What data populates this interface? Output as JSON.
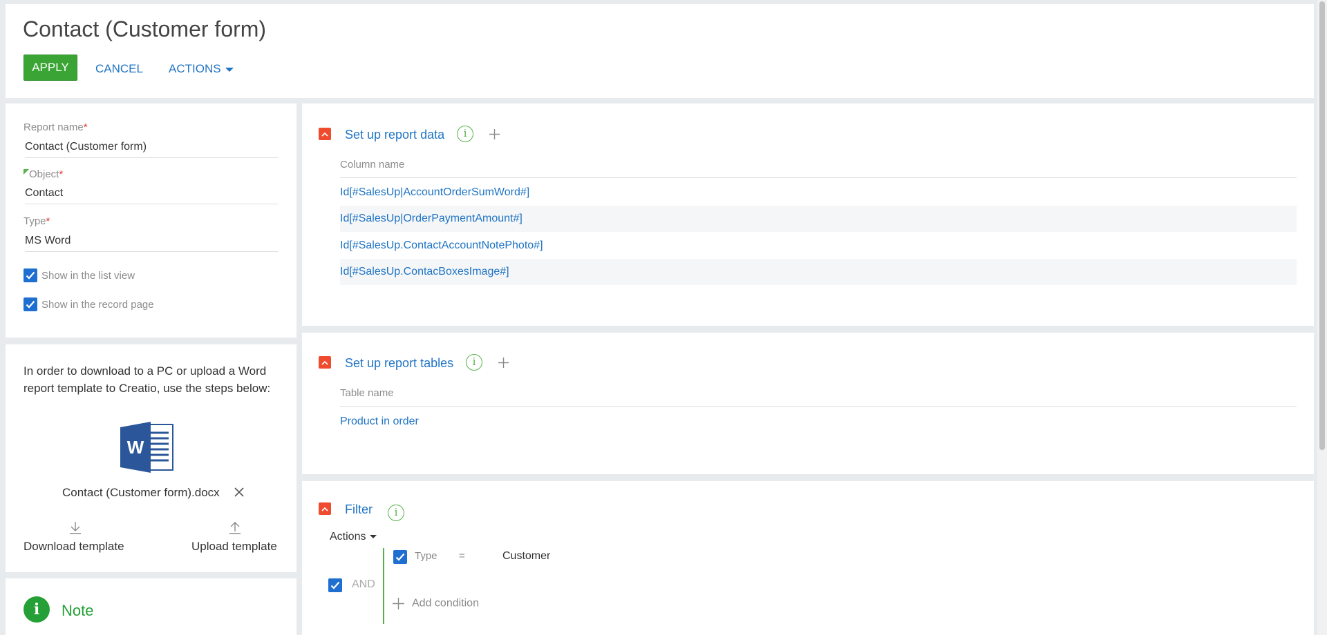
{
  "header": {
    "title": "Contact (Customer form)",
    "apply_label": "APPLY",
    "cancel_label": "CANCEL",
    "actions_label": "ACTIONS"
  },
  "properties": {
    "report_name_label": "Report name",
    "report_name_value": "Contact (Customer form)",
    "object_label": "Object",
    "object_value": "Contact",
    "type_label": "Type",
    "type_value": "MS Word",
    "required_mark": "*",
    "show_list_view_label": "Show in the list view",
    "show_list_view_checked": true,
    "show_record_page_label": "Show in the record page",
    "show_record_page_checked": true
  },
  "template": {
    "info_text": "In order to download to a PC or upload a Word report template to Creatio, use the steps below:",
    "file_name": "Contact (Customer form).docx",
    "download_label": "Download template",
    "upload_label": "Upload template",
    "icon": "word-file-icon"
  },
  "note": {
    "title": "Note"
  },
  "report_data": {
    "title": "Set up report data",
    "column_header": "Column name",
    "rows": [
      "Id[#SalesUp|AccountOrderSumWord#]",
      "Id[#SalesUp|OrderPaymentAmount#]",
      "Id[#SalesUp.ContactAccountNotePhoto#]",
      "Id[#SalesUp.ContacBoxesImage#]"
    ]
  },
  "report_tables": {
    "title": "Set up report tables",
    "column_header": "Table name",
    "rows": [
      "Product in order"
    ]
  },
  "filter": {
    "title": "Filter",
    "actions_label": "Actions",
    "group_operator": "AND",
    "condition": {
      "field": "Type",
      "operator": "=",
      "value": "Customer"
    },
    "add_condition_label": "Add condition"
  },
  "colors": {
    "accent": "#1f74c4",
    "apply": "#3aa534",
    "collapse": "#ef4b2f",
    "info": "#57b24a",
    "checkbox": "#1f6fd1"
  }
}
